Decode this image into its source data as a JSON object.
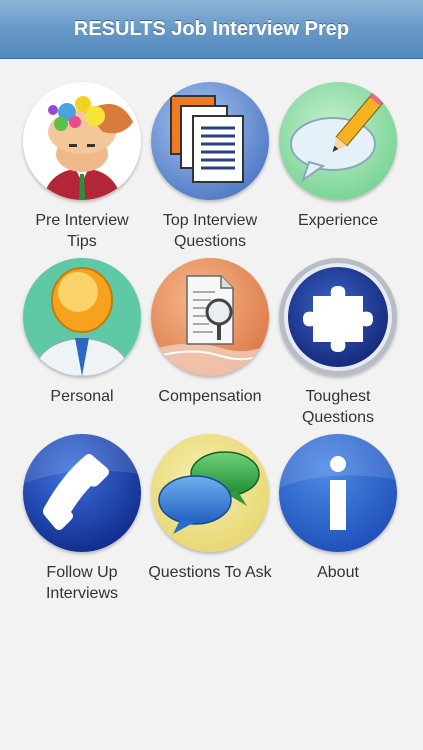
{
  "header": {
    "title": "RESULTS Job Interview Prep"
  },
  "menu": [
    {
      "label": "Pre Interview\nTips",
      "icon": "brain-lightbulb-icon"
    },
    {
      "label": "Top Interview\nQuestions",
      "icon": "documents-icon"
    },
    {
      "label": "Experience",
      "icon": "speech-bubble-pencil-icon"
    },
    {
      "label": "Personal",
      "icon": "person-icon"
    },
    {
      "label": "Compensation",
      "icon": "document-magnifier-icon"
    },
    {
      "label": "Toughest\nQuestions",
      "icon": "puzzle-icon"
    },
    {
      "label": "Follow Up\nInterviews",
      "icon": "phone-icon"
    },
    {
      "label": "Questions To Ask",
      "icon": "chat-bubbles-icon"
    },
    {
      "label": "About",
      "icon": "info-icon"
    }
  ],
  "colors": {
    "navbar": "#5b8fc4",
    "background": "#f2f2f2",
    "label_text": "#333333"
  }
}
